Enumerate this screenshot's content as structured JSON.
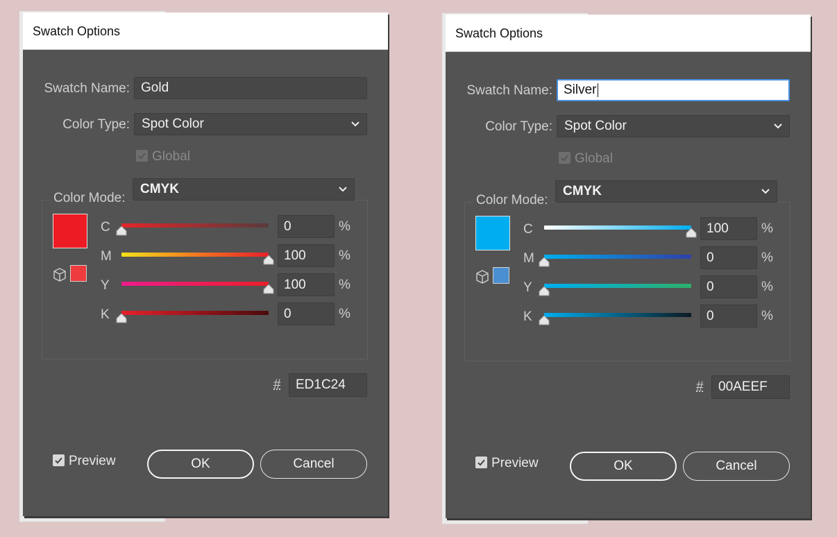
{
  "dialogs": [
    {
      "title": "Swatch Options",
      "name_label": "Swatch Name:",
      "name_value": "Gold",
      "color_type_label": "Color Type:",
      "color_type_value": "Spot Color",
      "global_label": "Global",
      "color_mode_label": "Color Mode:",
      "color_mode_value": "CMYK",
      "swatch_color": "#ED1C24",
      "gamut_color": "#EE3B3E",
      "channels": [
        {
          "label": "C",
          "value": "0",
          "unit": "%",
          "fraction": 0.0
        },
        {
          "label": "M",
          "value": "100",
          "unit": "%",
          "fraction": 1.0
        },
        {
          "label": "Y",
          "value": "100",
          "unit": "%",
          "fraction": 1.0
        },
        {
          "label": "K",
          "value": "0",
          "unit": "%",
          "fraction": 0.0
        }
      ],
      "hash_label": "#",
      "hex_value": "ED1C24",
      "preview_label": "Preview",
      "ok_label": "OK",
      "cancel_label": "Cancel"
    },
    {
      "title": "Swatch Options",
      "name_label": "Swatch Name:",
      "name_value": "Silver",
      "color_type_label": "Color Type:",
      "color_type_value": "Spot Color",
      "global_label": "Global",
      "color_mode_label": "Color Mode:",
      "color_mode_value": "CMYK",
      "swatch_color": "#00AEEF",
      "gamut_color": "#4A8FD1",
      "channels": [
        {
          "label": "C",
          "value": "100",
          "unit": "%",
          "fraction": 1.0
        },
        {
          "label": "M",
          "value": "0",
          "unit": "%",
          "fraction": 0.0
        },
        {
          "label": "Y",
          "value": "0",
          "unit": "%",
          "fraction": 0.0
        },
        {
          "label": "K",
          "value": "0",
          "unit": "%",
          "fraction": 0.0
        }
      ],
      "hash_label": "#",
      "hex_value": "00AEEF",
      "preview_label": "Preview",
      "ok_label": "OK",
      "cancel_label": "Cancel"
    }
  ],
  "track_gradients": [
    [
      "linear-gradient(90deg,#e2252a,#5a3a3c)",
      "linear-gradient(90deg,#f4e21a,#f07a22,#e8202a)",
      "linear-gradient(90deg,#ec1c8c,#e8202a)",
      "linear-gradient(90deg,#e8202a,#4a0a0c)"
    ],
    [
      "linear-gradient(90deg,#ffffff,#00aeef)",
      "linear-gradient(90deg,#00aeef,#2f3fa8)",
      "linear-gradient(90deg,#00aeef,#2db06a)",
      "linear-gradient(90deg,#00aeef,#0c1a22)"
    ]
  ]
}
